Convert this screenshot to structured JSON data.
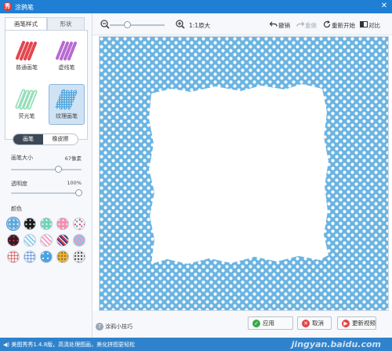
{
  "window": {
    "title": "涂鸦笔",
    "app_icon_glyph": "秀",
    "close_glyph": "✕"
  },
  "left_panel": {
    "tabs": [
      {
        "label": "画笔样式",
        "active": true
      },
      {
        "label": "形状",
        "active": false
      }
    ],
    "brushes": [
      {
        "label": "普通画笔",
        "icon": "solid-brush-icon",
        "color": "#e2474f",
        "selected": false
      },
      {
        "label": "虚线笔",
        "icon": "dotted-brush-icon",
        "color": "#b76ad0",
        "selected": false
      },
      {
        "label": "荧光笔",
        "icon": "highlighter-brush-icon",
        "color": "#7bd6a8",
        "selected": false
      },
      {
        "label": "纹理画笔",
        "icon": "texture-brush-icon",
        "color": "#5aa9dc",
        "selected": true
      }
    ],
    "mode_toggle": {
      "brush_label": "画笔",
      "eraser_label": "橡皮擦",
      "active": "brush"
    },
    "brush_size": {
      "label": "画笔大小",
      "value": "67像素",
      "level": 0.67
    },
    "opacity": {
      "label": "透明度",
      "value": "100%",
      "level": 1.0
    },
    "color_label": "颜色",
    "swatches": [
      {
        "name": "blue-white-dots",
        "selected": true
      },
      {
        "name": "black-white-dots"
      },
      {
        "name": "mint-dots"
      },
      {
        "name": "pink-dots"
      },
      {
        "name": "colorful-confetti"
      },
      {
        "name": "dark-burgundy"
      },
      {
        "name": "blue-white-stripes"
      },
      {
        "name": "pink-stripes"
      },
      {
        "name": "navy-red-stripes"
      },
      {
        "name": "pink-blue-stripes"
      },
      {
        "name": "red-plaid"
      },
      {
        "name": "blue-plaid"
      },
      {
        "name": "blue-floral"
      },
      {
        "name": "leopard-print"
      },
      {
        "name": "black-white-pattern"
      }
    ]
  },
  "toolbar": {
    "zoom_out_icon": "zoom-out-icon",
    "zoom_in_icon": "zoom-in-icon",
    "zoom_level": 0.3,
    "actual_size_label": "1:1原大",
    "undo_label": "撤销",
    "redo_label": "重做",
    "reset_label": "重新开始",
    "compare_label": "对比"
  },
  "canvas": {
    "pattern": "white dots on light blue",
    "background_color": "#6ab4e2",
    "dot_color": "#ffffff"
  },
  "bottom": {
    "tips_label": "涂鸦小技巧",
    "apply_label": "应用",
    "cancel_label": "取消",
    "tutorial_label": "更新视频"
  },
  "status_bar": {
    "text": "美图秀秀1.4.8版，高清处理图画，美化拼图更轻松",
    "watermark": "jingyan.baidu.com"
  }
}
